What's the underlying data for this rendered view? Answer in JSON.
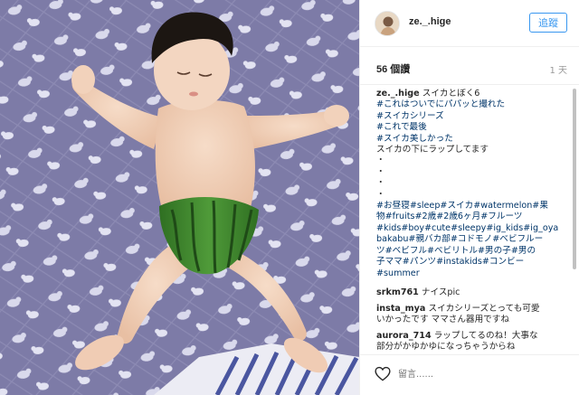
{
  "post": {
    "username": "ze._.hige",
    "follow_label": "追蹤",
    "likes": "56 個讚",
    "time_ago": "1 天"
  },
  "caption": {
    "username": "ze._.hige",
    "title": "スイカとぼく6",
    "lines": [
      {
        "kind": "tag",
        "text": "#これはついでにパパッと撮れた"
      },
      {
        "kind": "tag",
        "text": "#スイカシリーズ"
      },
      {
        "kind": "tag",
        "text": "#これで最後"
      },
      {
        "kind": "tag",
        "text": "#スイカ美しかった"
      },
      {
        "kind": "text",
        "text": "スイカの下にラップしてます"
      },
      {
        "kind": "text",
        "text": "・"
      },
      {
        "kind": "text",
        "text": "・"
      },
      {
        "kind": "text",
        "text": "・"
      },
      {
        "kind": "text",
        "text": "・"
      },
      {
        "kind": "tag",
        "text": "#お昼寝#sleep#スイカ#watermelon#果"
      },
      {
        "kind": "tag",
        "text": "物#fruits#2歳#2歳6ヶ月#フルーツ"
      },
      {
        "kind": "tag",
        "text": "#kids#boy#cute#sleepy#ig_kids#ig_oya"
      },
      {
        "kind": "tag",
        "text": "bakabu#親バカ部#コドモノ#ベビフルー"
      },
      {
        "kind": "tag",
        "text": "ツ#ベビフル#ベビリトル#男の子#男の"
      },
      {
        "kind": "tag",
        "text": "子ママ#パンツ#instakids#コンビー"
      },
      {
        "kind": "tag",
        "text": "#summer"
      }
    ]
  },
  "comments": [
    {
      "username": "srkm761",
      "lines": [
        "ナイスpic"
      ]
    },
    {
      "username": "insta_mya",
      "lines": [
        "スイカシリーズとっても可愛",
        "いかったです ママさん器用ですね"
      ]
    },
    {
      "username": "aurora_714",
      "lines": [
        "ラップしてるのね！大事な",
        "部分がかゆかゆになっちゃうからね"
      ]
    }
  ],
  "footer": {
    "comment_placeholder": "留言......"
  },
  "colors": {
    "accent": "#3897f0",
    "hashtag": "#003569",
    "blanket": "#7c7aa6",
    "watermelon": "#3f8a2e"
  }
}
